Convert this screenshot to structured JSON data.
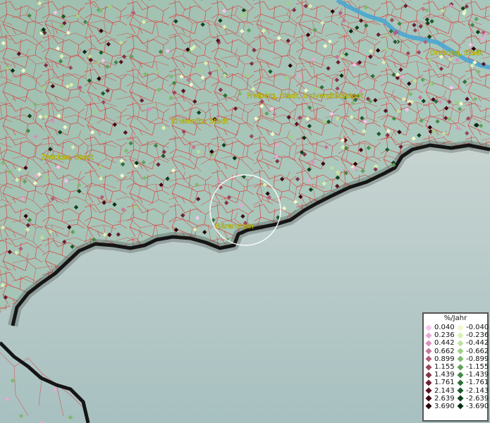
{
  "map": {
    "places": [
      {
        "name": "Dresden, Stadt"
      },
      {
        "name": "Freiberg, Stadt, Universitätsstadt"
      },
      {
        "name": "Chemnitz, Stadt"
      },
      {
        "name": "Zwickau, Stadt"
      },
      {
        "name": "Bärenstein"
      }
    ]
  },
  "legend": {
    "title": "%/Jahr",
    "positive": [
      {
        "value": "0.040",
        "color": "#f4c4ec"
      },
      {
        "value": "0.236",
        "color": "#e8a8d4"
      },
      {
        "value": "0.442",
        "color": "#d890bc"
      },
      {
        "value": "0.662",
        "color": "#c47898"
      },
      {
        "value": "0.899",
        "color": "#b0607c"
      },
      {
        "value": "1.155",
        "color": "#984860"
      },
      {
        "value": "1.439",
        "color": "#823448"
      },
      {
        "value": "1.761",
        "color": "#6c2034"
      },
      {
        "value": "2.143",
        "color": "#581424"
      },
      {
        "value": "2.639",
        "color": "#400a16"
      },
      {
        "value": "3.690",
        "color": "#28040a"
      }
    ],
    "negative": [
      {
        "value": "-0.040",
        "color": "#f0f8c8"
      },
      {
        "value": "-0.236",
        "color": "#d8f0b0"
      },
      {
        "value": "-0.442",
        "color": "#c0e09c"
      },
      {
        "value": "-0.662",
        "color": "#a0d084"
      },
      {
        "value": "-0.899",
        "color": "#80b870"
      },
      {
        "value": "-1.155",
        "color": "#60a05c"
      },
      {
        "value": "-1.439",
        "color": "#448848"
      },
      {
        "value": "-1.761",
        "color": "#2c703a"
      },
      {
        "value": "-2.143",
        "color": "#1c5a2c"
      },
      {
        "value": "-2.639",
        "color": "#0e4420"
      },
      {
        "value": "-3.690",
        "color": "#063014"
      }
    ]
  }
}
